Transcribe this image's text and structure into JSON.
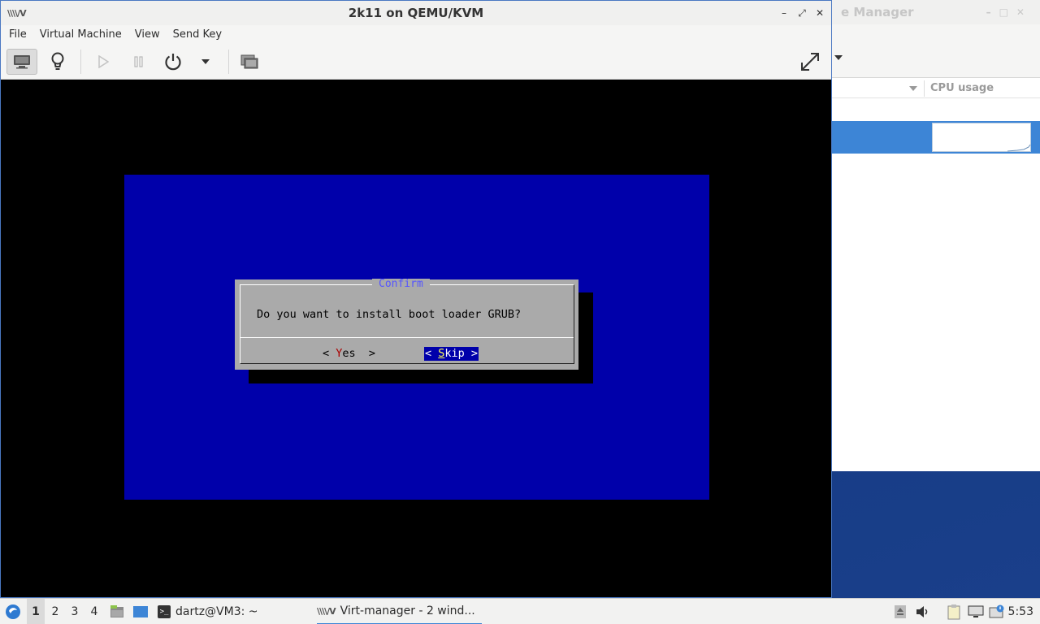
{
  "background_window": {
    "title_fragment": "e Manager",
    "column_cpu_usage": "CPU usage"
  },
  "vm_window": {
    "title": "2k11 on QEMU/KVM",
    "icon": "virt-manager-icon",
    "menu": [
      "File",
      "Virtual Machine",
      "View",
      "Send Key"
    ],
    "toolbar": {
      "items": [
        "console-view-icon",
        "details-lightbulb-icon",
        "run-icon",
        "pause-icon",
        "power-icon",
        "power-dropdown-icon",
        "snapshots-icon",
        "fullscreen-icon"
      ]
    }
  },
  "guest": {
    "dialog": {
      "title": "Confirm",
      "message": "Do you want to install boot loader GRUB?",
      "yes_left": "< ",
      "yes_hotkey": "Y",
      "yes_rest": "es  >",
      "skip_left": "< ",
      "skip_hotkey": "S",
      "skip_rest": "kip >",
      "selected": "Skip"
    },
    "colors": {
      "screen_bg": "#0000aa",
      "dialog_bg": "#aaaaaa",
      "title_fg": "#5555ff"
    }
  },
  "taskbar": {
    "workspaces": [
      "1",
      "2",
      "3",
      "4"
    ],
    "active_workspace": "1",
    "tasks": [
      {
        "label": "dartz@VM3: ~",
        "icon": "terminal-icon"
      },
      {
        "label": "Virt-manager - 2 wind...",
        "icon": "virt-manager-icon"
      }
    ],
    "tray_icons": [
      "eject-icon",
      "volume-icon",
      "clipboard-icon",
      "network-icon",
      "notification-icon"
    ],
    "clock": "5:53"
  }
}
